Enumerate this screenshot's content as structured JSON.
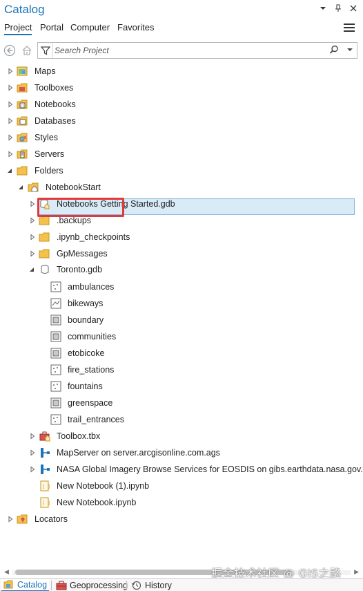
{
  "pane": {
    "title": "Catalog",
    "controls": {
      "dropdown": "▾",
      "pin": "📌",
      "close": "✕"
    }
  },
  "tabs": [
    {
      "label": "Project",
      "active": true
    },
    {
      "label": "Portal",
      "active": false
    },
    {
      "label": "Computer",
      "active": false
    },
    {
      "label": "Favorites",
      "active": false
    }
  ],
  "search": {
    "placeholder": "Search Project"
  },
  "tree": {
    "maps": "Maps",
    "toolboxes": "Toolboxes",
    "notebooks": "Notebooks",
    "databases": "Databases",
    "styles": "Styles",
    "servers": "Servers",
    "folders": "Folders",
    "notebookstart": "NotebookStart",
    "nb_getting_started_gdb": "Notebooks Getting Started.gdb",
    "backups": ".backups",
    "ipynb_checkpoints": ".ipynb_checkpoints",
    "gpmessages": "GpMessages",
    "toronto_gdb": "Toronto.gdb",
    "layers": [
      "ambulances",
      "bikeways",
      "boundary",
      "communities",
      "etobicoke",
      "fire_stations",
      "fountains",
      "greenspace",
      "trail_entrances"
    ],
    "toolbox_tbx": "Toolbox.tbx",
    "mapserver": "MapServer on server.arcgisonline.com.ags",
    "nasa": "NASA Global Imagery Browse Services for EOSDIS on gibs.earthdata.nasa.gov.wmt",
    "new_notebook_1": "New Notebook (1).ipynb",
    "new_notebook": "New Notebook.ipynb",
    "locators": "Locators"
  },
  "bottom_tabs": [
    {
      "label": "Catalog",
      "active": true
    },
    {
      "label": "Geoprocessing",
      "active": false
    },
    {
      "label": "History",
      "active": false
    }
  ],
  "watermark": "掘金技术社区 @ GIS之路",
  "colors": {
    "accent": "#1a73b8",
    "selection": "#d9ebf7",
    "highlight": "#e1383c",
    "folder": "#f4c24a"
  }
}
